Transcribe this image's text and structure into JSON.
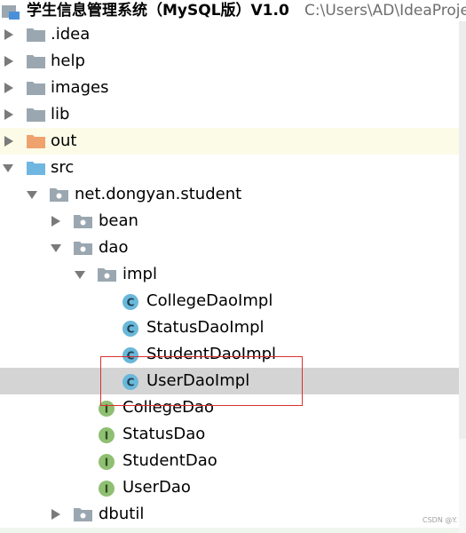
{
  "header": {
    "project_name": "学生信息管理系统（MySQL版）V1.0",
    "project_path": "C:\\Users\\AD\\IdeaProje"
  },
  "tree": {
    "idea": ".idea",
    "help": "help",
    "images": "images",
    "lib": "lib",
    "out": "out",
    "src": "src",
    "pkg_student": "net.dongyan.student",
    "bean": "bean",
    "dao": "dao",
    "impl": "impl",
    "college_dao_impl": "CollegeDaoImpl",
    "status_dao_impl": "StatusDaoImpl",
    "student_dao_impl": "StudentDaoImpl",
    "user_dao_impl": "UserDaoImpl",
    "college_dao": "CollegeDao",
    "status_dao": "StatusDao",
    "student_dao": "StudentDao",
    "user_dao": "UserDao",
    "dbutil": "dbutil"
  },
  "badges": {
    "class_letter": "C",
    "interface_letter": "I"
  },
  "watermark": "CSDN @Y.",
  "colors": {
    "folder": "#9aa7b0",
    "out_folder": "#f0a26e",
    "src_folder": "#6fb7e0",
    "class_badge": "#6ab8d9",
    "interface_badge": "#8fbf72",
    "selection": "#d4d4d4",
    "annotation_box": "#d9302f"
  }
}
